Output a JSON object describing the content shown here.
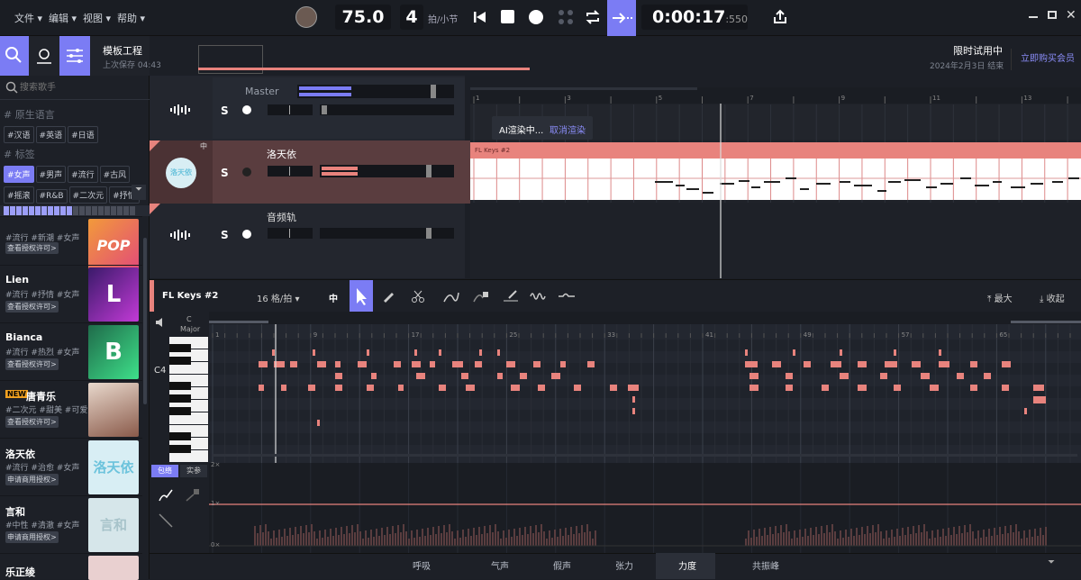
{
  "menu": {
    "file": "文件",
    "edit": "编辑",
    "view": "视图",
    "help": "帮助"
  },
  "transport": {
    "bpm": "75.0",
    "beats": "4",
    "beats_unit": "拍/小节",
    "time_main": "0:00:17",
    "time_ms": ":550"
  },
  "project": {
    "title": "模板工程",
    "saved": "上次保存 04:43"
  },
  "trial": {
    "title": "限时试用中",
    "date": "2024年2月3日 结束",
    "buy": "立即购买会员"
  },
  "search": {
    "placeholder": "搜索歌手"
  },
  "sections": {
    "native_lang": "# 原生语言",
    "tags": "# 标签"
  },
  "lang_tags": [
    "#汉语",
    "#英语",
    "#日语"
  ],
  "style_tags": [
    "#女声",
    "#男声",
    "#流行",
    "#古风",
    "#摇滚",
    "#R&B",
    "#二次元",
    "#抒情"
  ],
  "singers": [
    {
      "name": "",
      "tags": "#流行 #新潮 #女声",
      "license": "查看授权许可>",
      "thumb": "POP"
    },
    {
      "name": "Lien",
      "tags": "#流行 #抒情 #女声",
      "license": "查看授权许可>",
      "thumb": "L"
    },
    {
      "name": "Bianca",
      "tags": "#流行 #热烈 #女声",
      "license": "查看授权许可>",
      "thumb": "B"
    },
    {
      "name": "唐青乐",
      "badge": "NEW",
      "tags": "#二次元 #甜美 #可爱",
      "license": "查看授权许可>",
      "thumb": ""
    },
    {
      "name": "洛天依",
      "tags": "#流行 #治愈 #女声",
      "license": "申请商用授权>",
      "thumb": "洛天依"
    },
    {
      "name": "言和",
      "tags": "#中性 #清澈 #女声",
      "license": "申请商用授权>",
      "thumb": "言和"
    },
    {
      "name": "乐正绫",
      "tags": "",
      "license": "",
      "thumb": ""
    }
  ],
  "tracks": {
    "master": "Master",
    "singer_track": "洛天依",
    "audio_track": "音频轨",
    "solo": "S",
    "avatar_text": "洛天依"
  },
  "render": {
    "status": "AI渲染中...",
    "cancel": "取消渲染"
  },
  "clip": {
    "name": "FL Keys #2"
  },
  "ruler_top": [
    "1",
    "3",
    "5",
    "7",
    "9",
    "11",
    "13"
  ],
  "ruler_pr": [
    "1",
    "9",
    "17",
    "25",
    "33",
    "41",
    "49",
    "57",
    "65"
  ],
  "pr": {
    "instrument": "FL Keys #2",
    "grid": "16 格/拍",
    "mid": "中",
    "maximize": "最大",
    "collapse": "收起",
    "key": "C",
    "mode": "Major",
    "c4": "C4"
  },
  "bottom_tabs": {
    "envelope": "包络",
    "actual": "实参",
    "y_top": "2×",
    "y_mid": "1×",
    "y_bot": "0×"
  },
  "params": [
    "呼吸",
    "气声",
    "假声",
    "张力",
    "力度",
    "共振峰"
  ],
  "colors": {
    "accent": "#7b7cf4",
    "note": "#e8837d",
    "track_selected": "#5a3d3f"
  }
}
